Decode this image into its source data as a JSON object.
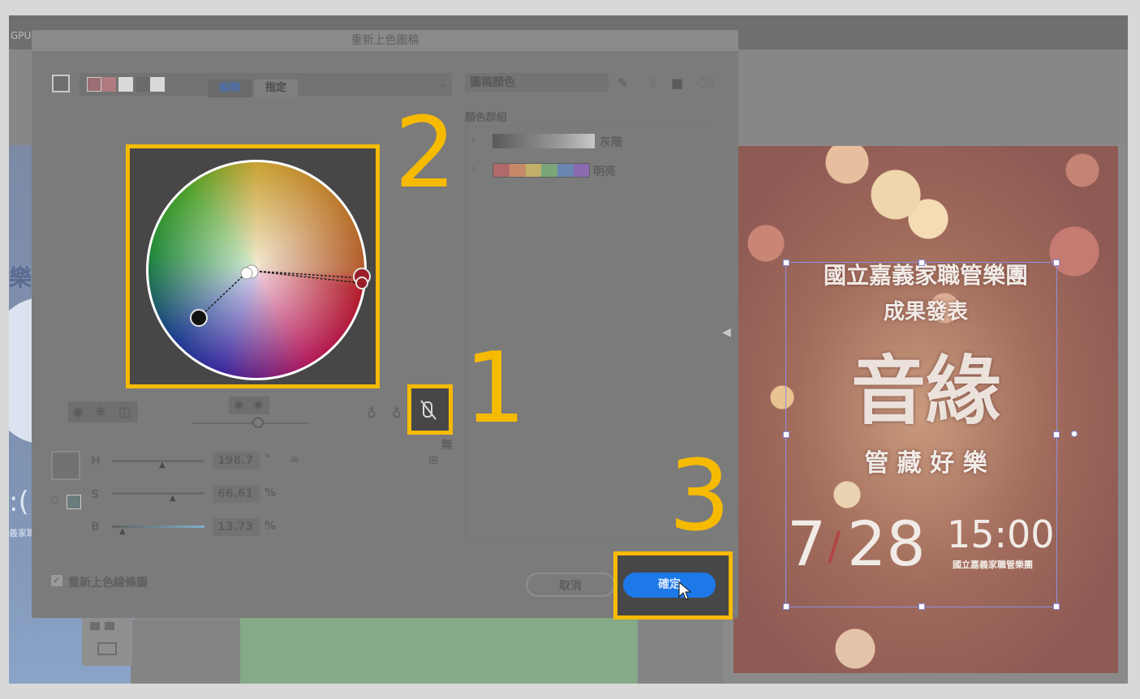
{
  "app": {
    "gpu_label": "GPU"
  },
  "dialog": {
    "title": "重新上色圖稿",
    "tab_edit": "編輯",
    "tab_assign": "指定",
    "artwork_colors_label": "圖稿顏色",
    "color_groups_label": "顏色群組",
    "groups": [
      {
        "name": "灰階"
      },
      {
        "name": "明亮"
      }
    ],
    "hsb": {
      "h_label": "H",
      "h_value": "198.7",
      "h_unit": "°",
      "s_label": "S",
      "s_value": "66.61",
      "s_unit": "%",
      "b_label": "B",
      "b_value": "13.73",
      "b_unit": "%"
    },
    "none_label": "無",
    "recolor_line_art_label": "重新上色線條圖",
    "cancel_label": "取消",
    "ok_label": "確定"
  },
  "annotations": {
    "n1": "1",
    "n2": "2",
    "n3": "3"
  },
  "poster": {
    "title_line1": "國立嘉義家職管樂團",
    "title_line2": "成果發表",
    "main_title": "音緣",
    "subtitle": "管 藏 好 樂",
    "date_month": "7",
    "date_slash": "/",
    "date_day": "28",
    "time": "15:00",
    "org": "國立嘉義家職管樂團"
  },
  "left_art": {
    "line1": "樂團",
    "line2": ":(",
    "line3": "義家職"
  },
  "colors": {
    "highlight": "#f6ba00",
    "ok_button": "#1d78e8"
  }
}
